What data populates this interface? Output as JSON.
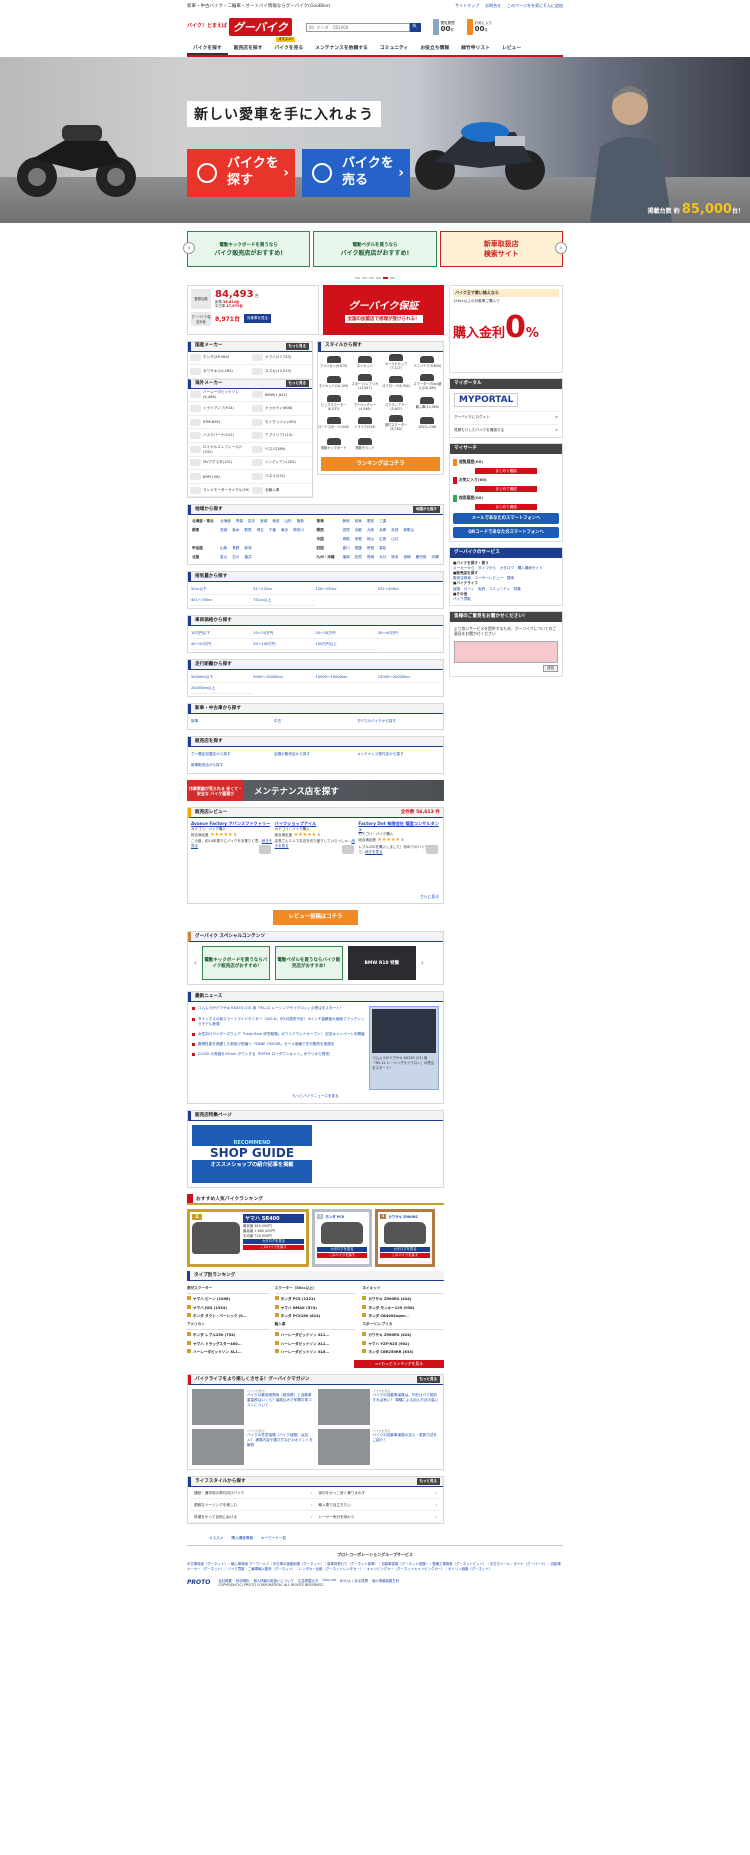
{
  "top": {
    "tagline": "新車・中古バイク・二輪車・オートバイ情報ならグーバイク(GooBike)",
    "links": [
      "サイトマップ",
      "お問合せ",
      "このページをを家にそんに追加"
    ]
  },
  "logo": {
    "small": "バイク！とまえば",
    "main": "グーバイク"
  },
  "search": {
    "placeholder": "例）ホンダ　CB1000",
    "btn": "🔍"
  },
  "counters": [
    {
      "label": "閲覧履歴",
      "value": "00",
      "unit": "件"
    },
    {
      "label": "お気に入り",
      "value": "00",
      "unit": "件"
    }
  ],
  "gnav": {
    "items": [
      "バイクを探す",
      "販売店を探す",
      "バイクを売る",
      "メンテナンスを依頼する",
      "コミュニティ",
      "お役立ち情報",
      "緑竹申リスト",
      "レビュー"
    ],
    "badge": "オススメ!"
  },
  "hero": {
    "catch": "新しい愛車を手に入れよう",
    "buy": [
      "バイクを",
      "探す"
    ],
    "sell": [
      "バイクを",
      "売る"
    ],
    "stock_label": "掲載台数",
    "stock_prefix": "約",
    "stock_value": "85,000",
    "stock_unit": "台！"
  },
  "strip": [
    {
      "l1": "電動キックボードを買うなら",
      "l2": "バイク販売店がおすすめ!",
      "red": false
    },
    {
      "l1": "電動ペダルを買うなら",
      "l2": "バイク販売店がおすすめ!",
      "red": false
    },
    {
      "l1": "新車取扱店",
      "l2": "検索サイト",
      "red": true
    }
  ],
  "stat": {
    "label": "登録台数",
    "total": "84,493",
    "unit": "台",
    "new_label": "新車",
    "new": "36,814台",
    "used_label": "中古車",
    "used": "47,679台",
    "hosho_label": "グーバイク保証対象",
    "hosho_val": "8,971台",
    "hosho_btn": "対象車を見る"
  },
  "hosho": {
    "title": "グーバイク保証",
    "sub": "全国の加盟店で修理が受けられる！"
  },
  "maker": {
    "jp_title": "国産メーカー",
    "more": "もっと見る",
    "jp": [
      "ホンダ(28,964)",
      "ヤマハ(17,733)",
      "カワサキ(10,264)",
      "スズキ(13,019)"
    ],
    "f_title": "海外メーカー",
    "f": [
      "ハーレーダビッドソン(4,488)",
      "BMW(1,842)",
      "トライアンフ(914)",
      "ドゥカティ(608)",
      "KTM(606)",
      "モトグッツィ(160)",
      "ハスクバーナ(101)",
      "アプリリア(115)",
      "ロイヤルエンフィールド(342)",
      "ベスパ(389)",
      "MVアグスタ(101)",
      "インディアン(202)",
      "BRP(158)",
      "ベネリ(251)",
      "ランドモーターサイクル(59)",
      "全輸入車"
    ]
  },
  "style": {
    "title": "スタイルから探す",
    "items": [
      "アメリカン(9,875)",
      "ネイキッド",
      "オールドルック(7,127)",
      "ミニバイク(9,600)",
      "ネイキッド(10,109)",
      "スポーツ/レプリカ(13,947)",
      "オフロード(8,304)",
      "スクーター(50cc超え)(10,495)",
      "ビッグスクーター(6,537)",
      "アドベンチャー(4,546)",
      "スクランブラー(3,657)",
      "輸入車(10,360)",
      "ロードスポーツ(440)",
      "トライク(329)",
      "原付スクーター(8,780)",
      "ATV(1,138)",
      "電動キックボード",
      "電動モペット"
    ],
    "rank_btn": "ランキングはコチラ"
  },
  "area": {
    "title": "地域から探す",
    "more": "地図から探す",
    "rows": [
      [
        "北海道・東北",
        [
          "北海道",
          "青森",
          "岩手",
          "宮城",
          "秋田",
          "山形",
          "福島"
        ],
        "東海",
        [
          "静岡",
          "岐阜",
          "愛知",
          "三重"
        ]
      ],
      [
        "関東",
        [
          "茨城",
          "栃木",
          "群馬",
          "埼玉",
          "千葉",
          "東京",
          "神奈川"
        ],
        "関西",
        [
          "滋賀",
          "京都",
          "大阪",
          "兵庫",
          "奈良",
          "和歌山"
        ]
      ],
      [
        "",
        [],
        "中国",
        [
          "鳥取",
          "島根",
          "岡山",
          "広島",
          "山口"
        ]
      ],
      [
        "甲信越",
        [
          "山梨",
          "長野",
          "新潟"
        ],
        "四国",
        [
          "香川",
          "愛媛",
          "徳島",
          "高知"
        ]
      ],
      [
        "北陸",
        [
          "富山",
          "石川",
          "福井"
        ],
        "九州・沖縄",
        [
          "福岡",
          "佐賀",
          "長崎",
          "大分",
          "熊本",
          "宮崎",
          "鹿児島",
          "沖縄"
        ]
      ]
    ]
  },
  "displacement": {
    "title": "排気量から探す",
    "items": [
      "50cc以下",
      "51〜125cc",
      "126〜250cc",
      "251〜400cc",
      "401〜750cc",
      "751cc以上"
    ]
  },
  "price": {
    "title": "車両価格から探す",
    "items": [
      "10万円以下",
      "10〜20万円",
      "20〜30万円",
      "30〜40万円",
      "40〜50万円",
      "50〜100万円",
      "100万円以上"
    ]
  },
  "mileage": {
    "title": "走行距離から探す",
    "items": [
      "5000km以下",
      "5000〜10000km",
      "10000〜15000km",
      "15000〜20000km",
      "20000km以上"
    ]
  },
  "newused": {
    "title": "新車・中古車から探す",
    "items": [
      "新車",
      "中古",
      "すべてのバイクから探す"
    ]
  },
  "shopsearch": {
    "title": "販売店を探す",
    "items": [
      "グー鑑定加盟店から探す",
      "全国の販売店から探す",
      "メンテナンス受付店から探す",
      "新車販売店から探す"
    ]
  },
  "maint": {
    "left": "作業実績が見られる 安くて・安全な バイク屋選び",
    "right": "メンテナンス店を探す"
  },
  "review": {
    "title": "販売店レビュー",
    "total": "全件数 56,613 件",
    "items": [
      {
        "shop": "Avance Factory アバンスファクトリー",
        "cat": "カテゴリ：バイク購入",
        "score": "5",
        "text": "この度、約10年振りにバイクを手乗りと思...",
        "more": "続きを見る"
      },
      {
        "shop": "バイクショップアイル",
        "cat": "カテゴリ：バイク購入",
        "score": "5",
        "text": "店長さん１人でお店を切り盛りしていらっしゃ...",
        "more": "続きを見る"
      },
      {
        "shop": "Factory Dot 有限会社 福室コンサルタント",
        "cat": "カテゴリ：バイク購入",
        "score": "5",
        "text": "レブル250を購入しました！初めてのバイク購入で...",
        "more": "続きを見る"
      }
    ],
    "rating_label": "総合満足度",
    "more": "さらに見る",
    "btn": "レビュー投稿はコチラ"
  },
  "special": {
    "title": "グーバイク スペシャルコンテンツ",
    "items": [
      "電動キックボードを買うならバイク販売店がおすすめ!",
      "電動ペダルを買うならバイク販売店がおすすめ!",
      "BMW R18 特集"
    ]
  },
  "news": {
    "title": "最新ニュース",
    "items": [
      "コムムラがドウサキ KX250 (23) 用「RS-12 レーシングサイクロン」の受注をスタート！",
      "タナックスの新スマートライドモニター「AIO-6」が5月発売予定！ 6インチ高解度大画面ブラックシックモデル登場",
      "女性向けライダーズウェア「Lady Blue 伊豆稲場」がフリアウンドオープン！ 記念キャンペーンを開催",
      "雲根性能を飛躍した新設け型番ツ「ENNE 75000R」セール価格で先行販売を実施中",
      "CL250 の角度を25mm ダウンする「EFFEX ローダウンキット」がデリから発売！"
    ],
    "pv_text": "コムムラがドウサキ KX250 (23) 用「RS-12 レーシングサイクロン」の受注をスタート！",
    "more": "もっとバイクニュースを見る"
  },
  "shopguide": {
    "title": "販売店特集ページ",
    "a": "RECOMMEND",
    "b": "SHOP GUIDE",
    "d": "オススメショップの紹介記事を掲載"
  },
  "ranking": {
    "title": "おすすめ人気バイクランキング",
    "top": [
      {
        "rank": "1",
        "name": "ヤマハ SR400",
        "p1": "最安値 380,000円",
        "p2": "最高値 1,680,000円",
        "p3": "平均値 726,909円",
        "b1": "カタログを見る",
        "b2": "このバイクを探す"
      },
      {
        "rank": "2",
        "name": "ホンダ PCX",
        "b1": "カタログを見る",
        "b2": "このバイクを探す"
      },
      {
        "rank": "3",
        "name": "カワサキ Z900RS",
        "b1": "カタログを見る",
        "b2": "このバイクを探す"
      }
    ],
    "type_title": "タイプ別ランキング",
    "types": [
      {
        "h": "原付スクーター",
        "r": [
          "ヤマハ ビーノ (1098)",
          "ヤマハ JOG (1334)",
          "ホンダ タクト・ベーシック (9..."
        ]
      },
      {
        "h": "スクーター（50cc以上）",
        "r": [
          "ホンダ PCX (1221)",
          "ヤマハ NMAX (574)",
          "ホンダ PCX160 (614)"
        ]
      },
      {
        "h": "ネイキッド",
        "r": [
          "カワサキ Z900RS (424)",
          "ホンダ モンキー125 (936)",
          "ホンダ CB400Super..."
        ]
      },
      {
        "h": "アメリカン",
        "r": [
          "ホンダ レブル250 (754)",
          "ヤマハ ドラッグスター400...",
          "ハーレーダビッドソン XL1..."
        ]
      },
      {
        "h": "輸入車",
        "r": [
          "ハーレーダビッドソン XL1...",
          "ハーレーダビッドソン XL1...",
          "ハーレーダビッドソン XL8..."
        ]
      },
      {
        "h": "スポーツ/レプリカ",
        "r": [
          "カワサキ Z900RS (424)",
          "ヤマハ YZF-R25 (902)",
          "ホンダ CBR250RR (633)"
        ]
      }
    ],
    "more": ">>もっとランキングを見る"
  },
  "magazine": {
    "title": "バイクライフをより楽しくさせる！グーバイクマガジン",
    "more": "もっと見る",
    "items": [
      {
        "tag": "バイクを知る",
        "t": "バイクの最低維費用（維持費）と自動車重量税はいくら？保険込みで年間平常コストについて"
      },
      {
        "tag": "バイクを知る",
        "t": "バイクの自動車保険は、何を比べて契約すれば良い？ 車種による加入方法の違い"
      },
      {
        "tag": "バイクを知る",
        "t": "バイクの任意保険（バイク保険）は加入？ 補償内容や選び方などのポイントを解説"
      },
      {
        "tag": "バイクを知る",
        "t": "バイクの自動車保険の加入・更新方法をご紹介！"
      }
    ]
  },
  "lifestyle": {
    "title": "ライフスタイルから探す",
    "more": "もっと見る",
    "items": [
      "通勤・通学用の原付向けバイク",
      "街中をかっこ良く乗りまわす",
      "優雅なツーリングを楽しむ",
      "輸入車で目立ちたい",
      "林道をかって自然にぬける",
      "レーサー気分を味わう"
    ]
  },
  "side": {
    "ad": {
      "t": "バイク王で買い換えなら",
      "s": "126cc以上の対象車ご購入で",
      "big_a": "購入金利",
      "big_b": "0",
      "big_c": "%"
    },
    "myportal": {
      "title": "マイポータル",
      "logo": "MYPORTAL",
      "r1": "グーバイクにログイン",
      "r2": "見積もりしたバイクを確認する"
    },
    "mysearch": {
      "title": "マイサーチ",
      "hist": "閲覧履歴(00)",
      "fav": "お気に入り(00)",
      "cond": "検索履歴(00)",
      "btn": "まとめて確認",
      "mail": "メールであなたのスマートフォンへ",
      "qr": "QRコードであなたのスマートフォンへ"
    },
    "service": {
      "title": "グーバイクのサービス",
      "groups": [
        {
          "h": "■バイクを探す・買う",
          "l": "メーカーから　タイプから　カタログ　購入講研ガイド"
        },
        {
          "h": "■販売店を探す",
          "l": "販売店検索　ユーザーレビュー　整納"
        },
        {
          "h": "■バイクライフ",
          "l": "保険　ローン　免許　コミュニティ　特集"
        },
        {
          "h": "■その他",
          "l": "バイク買取"
        }
      ]
    },
    "voice": {
      "title": "皆様のご意見をお聞かせください！",
      "text": "より良いサービスを提供するため、グーバイクについてのご意見をお聞かせください",
      "btn": "送信"
    }
  },
  "footer": {
    "links": [
      "オススメ",
      "購入講座情報",
      "キーワード一覧"
    ],
    "group": "プロトコーポレーショングループサービス",
    "list": "中古車検索（グーネット）｜輸入車検索 グーワールド｜中古車の価格相場（グーネット）｜新車見積もり（グーネット新車）｜自動車保険（グーネット保険）｜整備工場検索（グーネットピット）｜中古ホイール・タイヤ（グーパーツ）｜自動車メーカー（グーネット）｜バイク買取｜二輪車輸入販売（グーネット）｜レンタカー比較（グーネットレンタカー）｜キャンピングカー（グーネットキャンピングカー）｜ガソリン価格（グーネット）",
    "copy": "COPYRIGHT(C) PROTO CORPORATION. ALL RIGHTS RESERVED.",
    "brand": "PROTO",
    "bottom_links": [
      "会社概要",
      "利用規約",
      "個人情報の取扱いについて",
      "広告掲載の方",
      "Goo-net",
      "BOOよくある質問",
      "個人情報保護方針"
    ]
  }
}
